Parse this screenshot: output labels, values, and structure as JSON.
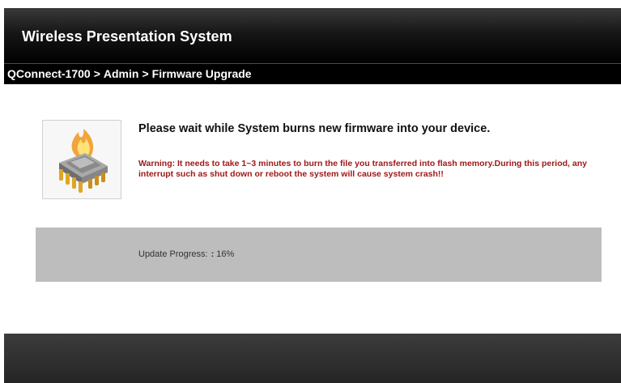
{
  "header": {
    "title": "Wireless Presentation System"
  },
  "breadcrumb": {
    "items": [
      "QConnect-1700",
      "Admin",
      "Firmware Upgrade"
    ],
    "separator": ">"
  },
  "status": {
    "icon": "firmware-chip-icon",
    "main_message": "Please wait while System burns new firmware into your device.",
    "warning": "Warning: It needs to take 1~3 minutes to burn the file you transferred into flash memory.During this period, any interrupt such as shut down or reboot the system will cause system crash!!"
  },
  "progress": {
    "label": "Update Progress:",
    "separator": ":",
    "value_text": "16%",
    "value": 0.16
  },
  "colors": {
    "header_bg": "#000000",
    "warning_text": "#a01818",
    "progress_panel_bg": "#bdbdbd",
    "footer_bg": "#2e2e2e"
  }
}
